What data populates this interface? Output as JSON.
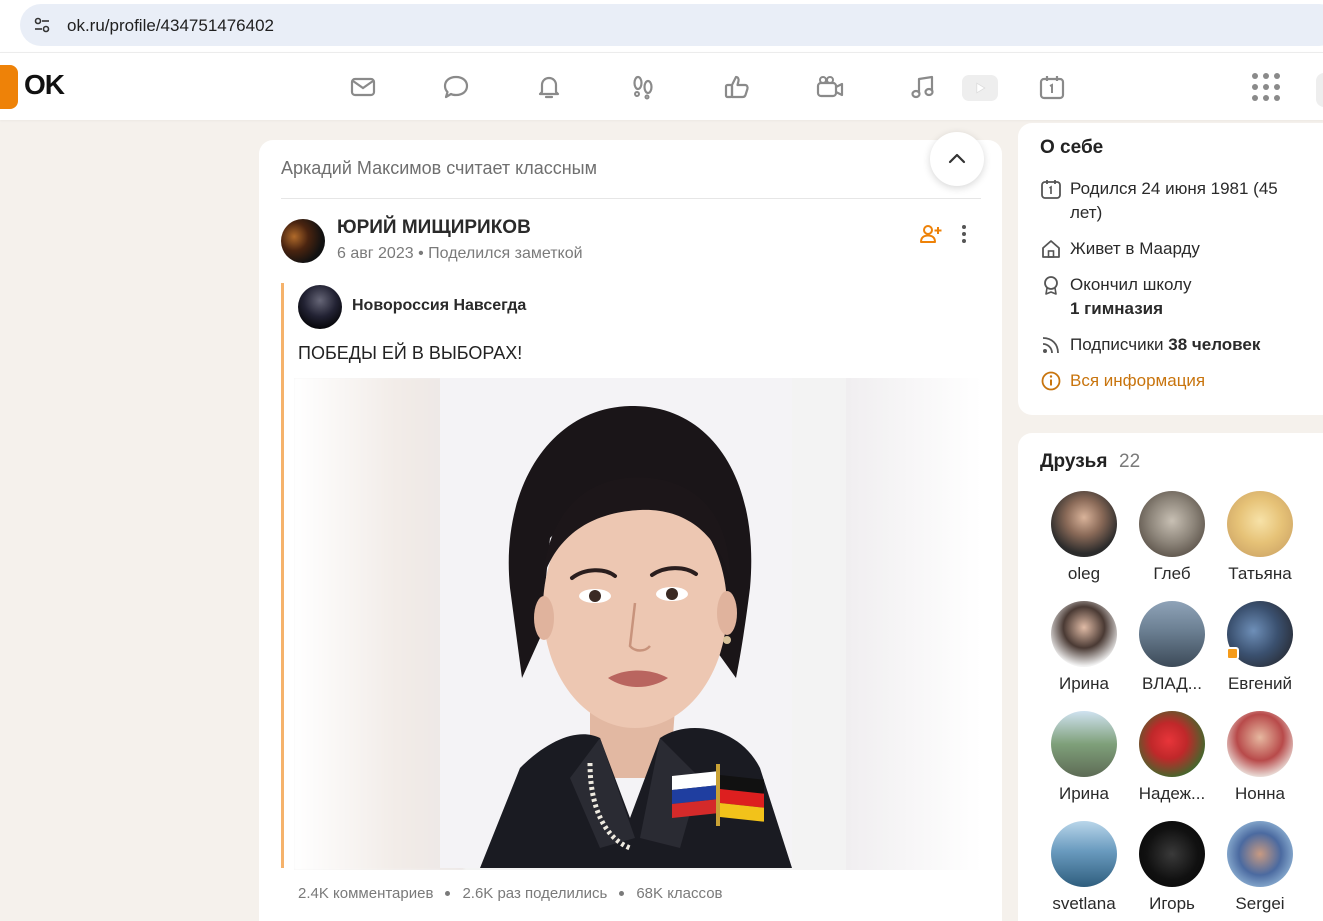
{
  "browser": {
    "url": "ok.ru/profile/434751476402"
  },
  "nav": {
    "logo": "OK",
    "icons": [
      "mail-icon",
      "chat-icon",
      "bell-icon",
      "footprints-icon",
      "like-icon",
      "video-camera-icon",
      "music-icon",
      "play-icon",
      "calendar-icon",
      "apps-grid-icon"
    ]
  },
  "feed": {
    "liked_by": "Аркадий Максимов считает классным",
    "post": {
      "author": "ЮРИЙ МИЩИРИКОВ",
      "date": "6 авг 2023",
      "action": "Поделился заметкой",
      "meta_separator": "•",
      "group": "Новороссия Навсегда",
      "text": "ПОБЕДЫ ЕЙ В ВЫБОРАХ!",
      "stats": {
        "comments": "2.4K комментариев",
        "shares": "2.6K раз поделились",
        "likes": "68K классов"
      }
    }
  },
  "about": {
    "title": "О себе",
    "born": "Родился 24 июня 1981 (45 лет)",
    "lives_prefix": "Живет в ",
    "lives_city": "Маарду",
    "school_prefix": "Окончил школу",
    "school_name": "1 гимназия",
    "subscribers_prefix": "Подписчики ",
    "subscribers_count": "38 человек",
    "all_info": "Вся информация"
  },
  "friends": {
    "title": "Друзья",
    "count": "22",
    "items": [
      {
        "name": "oleg"
      },
      {
        "name": "Глеб"
      },
      {
        "name": "Татьяна"
      },
      {
        "name": "Ирина"
      },
      {
        "name": "ВЛАД..."
      },
      {
        "name": "Евгений"
      },
      {
        "name": "Ирина"
      },
      {
        "name": "Надеж..."
      },
      {
        "name": "Нонна"
      },
      {
        "name": "svetlana"
      },
      {
        "name": "Игорь"
      },
      {
        "name": "Sergei"
      }
    ]
  },
  "colors": {
    "accent": "#ee8208",
    "link": "#c8740d",
    "page_bg": "#f5f1ec"
  }
}
